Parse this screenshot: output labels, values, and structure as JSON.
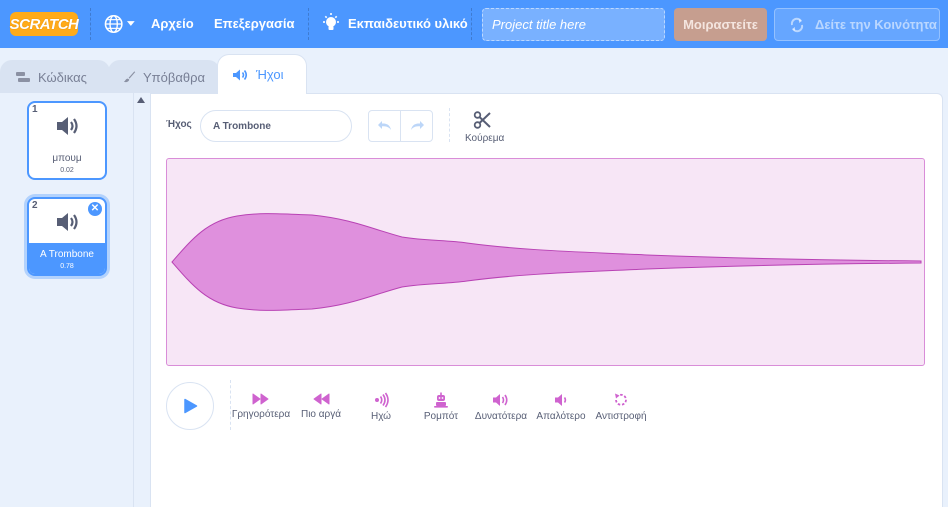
{
  "menubar": {
    "logo_text": "SCRATCH",
    "file_label": "Αρχείο",
    "edit_label": "Επεξεργασία",
    "tutorials_label": "Εκπαιδευτικό υλικό",
    "project_title_placeholder": "Project title here",
    "share_label": "Μοιραστείτε",
    "see_community_label": "Δείτε την Κοινότητα"
  },
  "tabs": {
    "code": "Κώδικας",
    "backdrops": "Υπόβαθρα",
    "sounds": "Ήχοι"
  },
  "sounds": [
    {
      "number": "1",
      "name": "μπουμ",
      "duration": "0.02"
    },
    {
      "number": "2",
      "name": "A Trombone",
      "duration": "0.78"
    }
  ],
  "editor": {
    "sound_label": "Ήχος",
    "sound_name_value": "A Trombone",
    "trim_label": "Κούρεμα"
  },
  "effects": {
    "faster": "Γρηγορότερα",
    "slower": "Πιο αργά",
    "echo": "Ηχώ",
    "robot": "Ρομπότ",
    "louder": "Δυνατότερα",
    "softer": "Απαλότερο",
    "reverse": "Αντιστροφή"
  },
  "colors": {
    "brand_blue": "#4c97ff",
    "sound_magenta": "#cf63cf",
    "waveform_bg": "#f7e6f6"
  }
}
